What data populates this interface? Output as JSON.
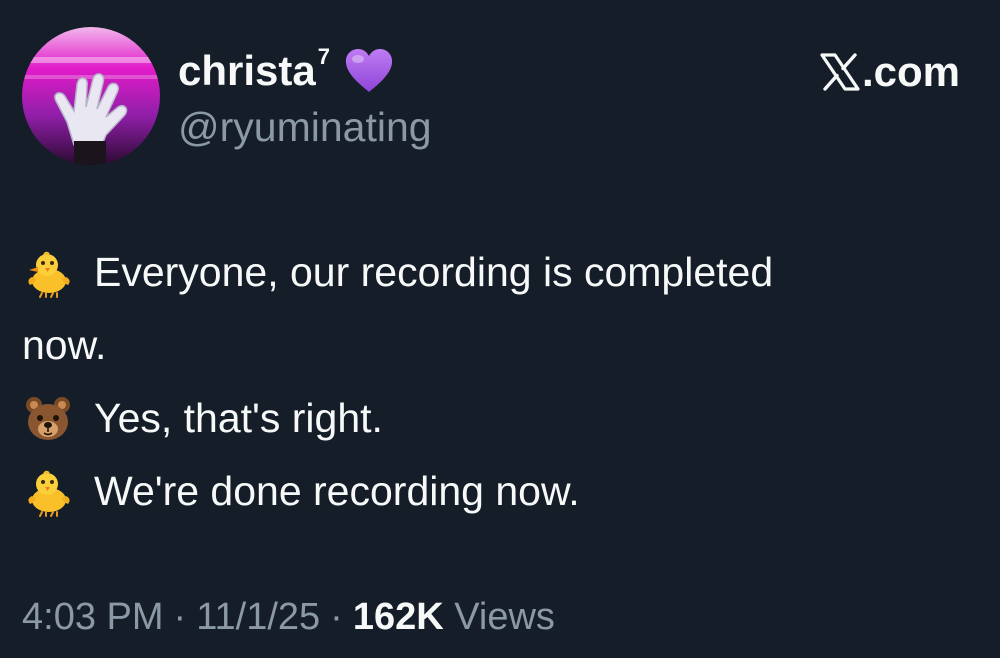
{
  "author": {
    "display_name": "christa",
    "display_name_sup": "7",
    "handle": "@ryuminating",
    "badge_icon": "purple-heart-icon",
    "avatar_colors": [
      "#e21cc9",
      "#9a1fb0",
      "#3a0c3e"
    ]
  },
  "brand": {
    "label": ".com",
    "logo_icon": "x-logo-icon"
  },
  "tweet": {
    "lines": [
      {
        "emoji": "baby-chick-icon",
        "text": "Everyone, our recording is completed"
      },
      {
        "emoji": "",
        "text": "now."
      },
      {
        "emoji": "bear-face-icon",
        "text": "Yes, that's right."
      },
      {
        "emoji": "baby-chick-icon",
        "text": "We're done recording now."
      }
    ]
  },
  "meta": {
    "time": "4:03 PM",
    "separator": "·",
    "date": "11/1/25",
    "views_count": "162K",
    "views_label": "Views"
  },
  "colors": {
    "background": "#151d28",
    "text_primary": "#f7f9f9",
    "text_secondary": "#8b98a5",
    "heart": "#a155e8"
  }
}
